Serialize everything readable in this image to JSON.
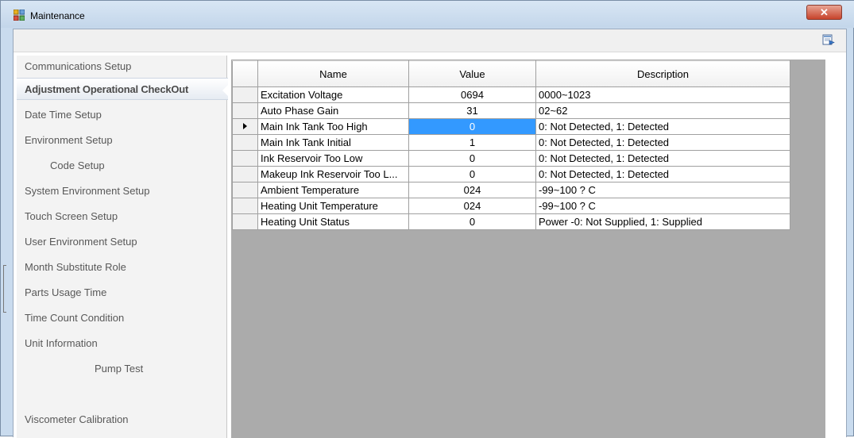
{
  "window": {
    "title": "Maintenance",
    "close_label": "✕"
  },
  "sidebar": {
    "items": [
      {
        "label": "Communications Setup",
        "selected": false
      },
      {
        "label": "Adjustment Operational CheckOut",
        "selected": true
      },
      {
        "label": "Date Time Setup",
        "selected": false
      },
      {
        "label": "Environment Setup",
        "selected": false
      },
      {
        "label": "Code Setup",
        "selected": false
      },
      {
        "label": "System Environment Setup",
        "selected": false
      },
      {
        "label": "Touch Screen Setup",
        "selected": false
      },
      {
        "label": "User Environment Setup",
        "selected": false
      },
      {
        "label": "Month Substitute Role",
        "selected": false
      },
      {
        "label": "Parts Usage Time",
        "selected": false
      },
      {
        "label": "Time Count Condition",
        "selected": false
      },
      {
        "label": "Unit Information",
        "selected": false
      },
      {
        "label": "Pump Test",
        "selected": false
      },
      {
        "label": "",
        "selected": false
      },
      {
        "label": "Viscometer Calibration",
        "selected": false
      }
    ]
  },
  "grid": {
    "headers": {
      "name": "Name",
      "value": "Value",
      "description": "Description"
    },
    "rows": [
      {
        "name": "Excitation Voltage",
        "value": "0694",
        "description": "0000~1023"
      },
      {
        "name": "Auto Phase Gain",
        "value": "31",
        "description": "02~62"
      },
      {
        "name": "Main Ink Tank Too High",
        "value": "0",
        "description": "0: Not Detected, 1: Detected",
        "current": true
      },
      {
        "name": "Main Ink Tank Initial",
        "value": "1",
        "description": "0: Not Detected, 1: Detected"
      },
      {
        "name": "Ink Reservoir Too Low",
        "value": "0",
        "description": "0: Not Detected, 1: Detected"
      },
      {
        "name": "Makeup Ink Reservoir Too L...",
        "value": "0",
        "description": "0: Not Detected, 1: Detected"
      },
      {
        "name": "Ambient Temperature",
        "value": "024",
        "description": "-99~100 ? C"
      },
      {
        "name": "Heating Unit Temperature",
        "value": "024",
        "description": "-99~100 ? C"
      },
      {
        "name": "Heating Unit Status",
        "value": "0",
        "description": "Power -0: Not Supplied, 1: Supplied"
      }
    ]
  },
  "colors": {
    "selection": "#3399ff",
    "grid_background": "#ababab"
  }
}
